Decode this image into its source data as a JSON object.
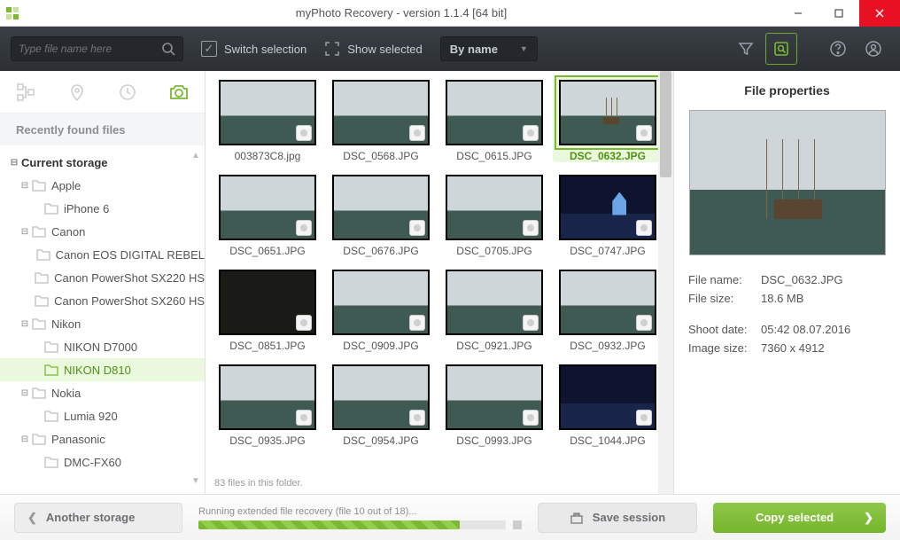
{
  "window": {
    "title": "myPhoto Recovery - version 1.1.4 [64 bit]"
  },
  "toolbar": {
    "search_placeholder": "Type file name here",
    "switch_selection": "Switch selection",
    "show_selected": "Show selected",
    "sort_by": "By name"
  },
  "sidebar": {
    "recent_label": "Recently found files",
    "tree": [
      {
        "label": "Current storage",
        "level": 0,
        "bold": true,
        "expanded": true
      },
      {
        "label": "Apple",
        "level": 1,
        "expanded": true
      },
      {
        "label": "iPhone 6",
        "level": 2
      },
      {
        "label": "Canon",
        "level": 1,
        "expanded": true
      },
      {
        "label": "Canon EOS DIGITAL REBEL",
        "level": 2
      },
      {
        "label": "Canon PowerShot SX220 HS",
        "level": 2
      },
      {
        "label": "Canon PowerShot SX260 HS",
        "level": 2
      },
      {
        "label": "Nikon",
        "level": 1,
        "expanded": true
      },
      {
        "label": "NIKON D7000",
        "level": 2
      },
      {
        "label": "NIKON D810",
        "level": 2,
        "selected": true
      },
      {
        "label": "Nokia",
        "level": 1,
        "expanded": true
      },
      {
        "label": "Lumia 920",
        "level": 2
      },
      {
        "label": "Panasonic",
        "level": 1,
        "expanded": true
      },
      {
        "label": "DMC-FX60",
        "level": 2
      }
    ]
  },
  "gallery": {
    "count_text": "83 files in this folder.",
    "items": [
      {
        "name": "003873C8.jpg",
        "kind": "sky"
      },
      {
        "name": "DSC_0568.JPG",
        "kind": "sky"
      },
      {
        "name": "DSC_0615.JPG",
        "kind": "sky"
      },
      {
        "name": "DSC_0632.JPG",
        "kind": "ship",
        "selected": true
      },
      {
        "name": "DSC_0651.JPG",
        "kind": "sky"
      },
      {
        "name": "DSC_0676.JPG",
        "kind": "sky"
      },
      {
        "name": "DSC_0705.JPG",
        "kind": "sky"
      },
      {
        "name": "DSC_0747.JPG",
        "kind": "castle"
      },
      {
        "name": "DSC_0851.JPG",
        "kind": "dark"
      },
      {
        "name": "DSC_0909.JPG",
        "kind": "sky"
      },
      {
        "name": "DSC_0921.JPG",
        "kind": "sky"
      },
      {
        "name": "DSC_0932.JPG",
        "kind": "sky"
      },
      {
        "name": "DSC_0935.JPG",
        "kind": "sky"
      },
      {
        "name": "DSC_0954.JPG",
        "kind": "sky"
      },
      {
        "name": "DSC_0993.JPG",
        "kind": "sky"
      },
      {
        "name": "DSC_1044.JPG",
        "kind": "night"
      }
    ]
  },
  "properties": {
    "heading": "File properties",
    "file_name_label": "File name:",
    "file_name": "DSC_0632.JPG",
    "file_size_label": "File size:",
    "file_size": "18.6 MB",
    "shoot_date_label": "Shoot date:",
    "shoot_date": "05:42 08.07.2016",
    "image_size_label": "Image size:",
    "image_size": "7360 x 4912"
  },
  "bottom": {
    "another": "Another storage",
    "progress_text": "Running extended file recovery (file 10 out of 18)...",
    "progress_pct": 85,
    "save": "Save session",
    "copy": "Copy selected"
  },
  "colors": {
    "accent": "#7bb933"
  }
}
